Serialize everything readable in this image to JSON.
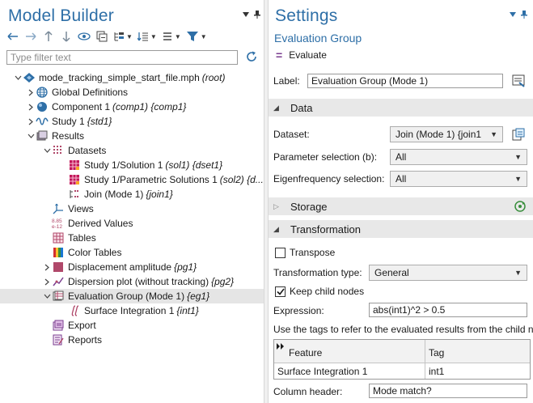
{
  "model_builder": {
    "title": "Model Builder",
    "filter_placeholder": "Type filter text",
    "tree": [
      {
        "label": "mode_tracking_simple_start_file.mph",
        "tag": "(root)"
      },
      {
        "label": "Global Definitions",
        "tag": ""
      },
      {
        "label": "Component 1",
        "tag": "(comp1) {comp1}"
      },
      {
        "label": "Study 1",
        "tag": "{std1}"
      },
      {
        "label": "Results",
        "tag": ""
      },
      {
        "label": "Datasets",
        "tag": ""
      },
      {
        "label": "Study 1/Solution 1",
        "tag": "(sol1) {dset1}"
      },
      {
        "label": "Study 1/Parametric Solutions 1",
        "tag": "(sol2) {d..."
      },
      {
        "label": "Join (Mode 1)",
        "tag": "{join1}"
      },
      {
        "label": "Views",
        "tag": ""
      },
      {
        "label": "Derived Values",
        "tag": ""
      },
      {
        "label": "Tables",
        "tag": ""
      },
      {
        "label": "Color Tables",
        "tag": ""
      },
      {
        "label": "Displacement amplitude",
        "tag": "{pg1}"
      },
      {
        "label": "Dispersion plot (without tracking)",
        "tag": "{pg2}"
      },
      {
        "label": "Evaluation Group (Mode 1)",
        "tag": "{eg1}"
      },
      {
        "label": "Surface Integration 1",
        "tag": "{int1}"
      },
      {
        "label": "Export",
        "tag": ""
      },
      {
        "label": "Reports",
        "tag": ""
      }
    ]
  },
  "settings": {
    "title": "Settings",
    "subtitle": "Evaluation Group",
    "evaluate_label": "Evaluate",
    "label_field": {
      "label": "Label:",
      "value": "Evaluation Group (Mode 1)"
    },
    "sections": {
      "data": "Data",
      "storage": "Storage",
      "transformation": "Transformation"
    },
    "dataset": {
      "label": "Dataset:",
      "value": "Join (Mode 1) {join1"
    },
    "parameter_selection": {
      "label": "Parameter selection (b):",
      "value": "All"
    },
    "eigenfrequency_selection": {
      "label": "Eigenfrequency selection:",
      "value": "All"
    },
    "transpose": {
      "label": "Transpose",
      "checked": false
    },
    "transformation_type": {
      "label": "Transformation type:",
      "value": "General"
    },
    "keep_child_nodes": {
      "label": "Keep child nodes",
      "checked": true
    },
    "expression": {
      "label": "Expression:",
      "value": "abs(int1)^2 > 0.5"
    },
    "note": "Use the tags to refer to the evaluated results from the child n",
    "table": {
      "columns": [
        "Feature",
        "Tag"
      ],
      "rows": [
        {
          "feature": "Surface Integration 1",
          "tag": "int1"
        }
      ]
    },
    "column_header": {
      "label": "Column header:",
      "value": "Mode match?"
    }
  },
  "colors": {
    "accent": "#2e6fa7",
    "selection": "#cce4f7",
    "section_bg": "#e8e8e8"
  }
}
